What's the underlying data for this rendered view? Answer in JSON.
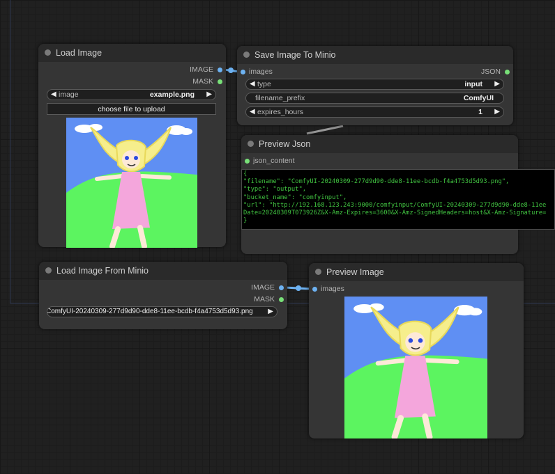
{
  "nodes": {
    "load_image": {
      "title": "Load Image",
      "outputs": [
        "IMAGE",
        "MASK"
      ],
      "image_widget": {
        "label": "image",
        "value": "example.png"
      },
      "upload_button": "choose file to upload"
    },
    "save_image_minio": {
      "title": "Save Image To Minio",
      "input": "images",
      "output": "JSON",
      "widgets": [
        {
          "label": "type",
          "value": "input",
          "kind": "combo"
        },
        {
          "label": "filename_prefix",
          "value": "ComfyUI",
          "kind": "text"
        },
        {
          "label": "expires_hours",
          "value": "1",
          "kind": "number"
        }
      ]
    },
    "preview_json": {
      "title": "Preview Json",
      "input": "json_content",
      "lines": [
        "{",
        "\"filename\": \"ComfyUI-20240309-277d9d90-dde8-11ee-bcdb-f4a4753d5d93.png\",",
        "\"type\": \"output\",",
        "\"bucket_name\": \"comfyinput\",",
        "\"url\": \"http://192.168.123.243:9000/comfyinput/ComfyUI-20240309-277d9d90-dde8-11ee",
        "Date=20240309T073926Z&X-Amz-Expires=3600&X-Amz-SignedHeaders=host&X-Amz-Signature=",
        "}"
      ]
    },
    "load_image_minio": {
      "title": "Load Image From Minio",
      "outputs": [
        "IMAGE",
        "MASK"
      ],
      "widget_value": "ComfyUI-20240309-277d9d90-dde8-11ee-bcdb-f4a4753d5d93.png",
      "widget_label_overlap": "i..."
    },
    "preview_image": {
      "title": "Preview Image",
      "input": "images"
    }
  },
  "colors": {
    "image_link": "#6db2f2",
    "json_link": "#78e078",
    "json_text": "#41c441",
    "sky": "#5f8ff3",
    "grass": "#5cf460",
    "dress": "#f4a6dc",
    "hair": "#f6ee8c"
  },
  "icons": {
    "left_arrow": "◀",
    "right_arrow": "▶"
  }
}
